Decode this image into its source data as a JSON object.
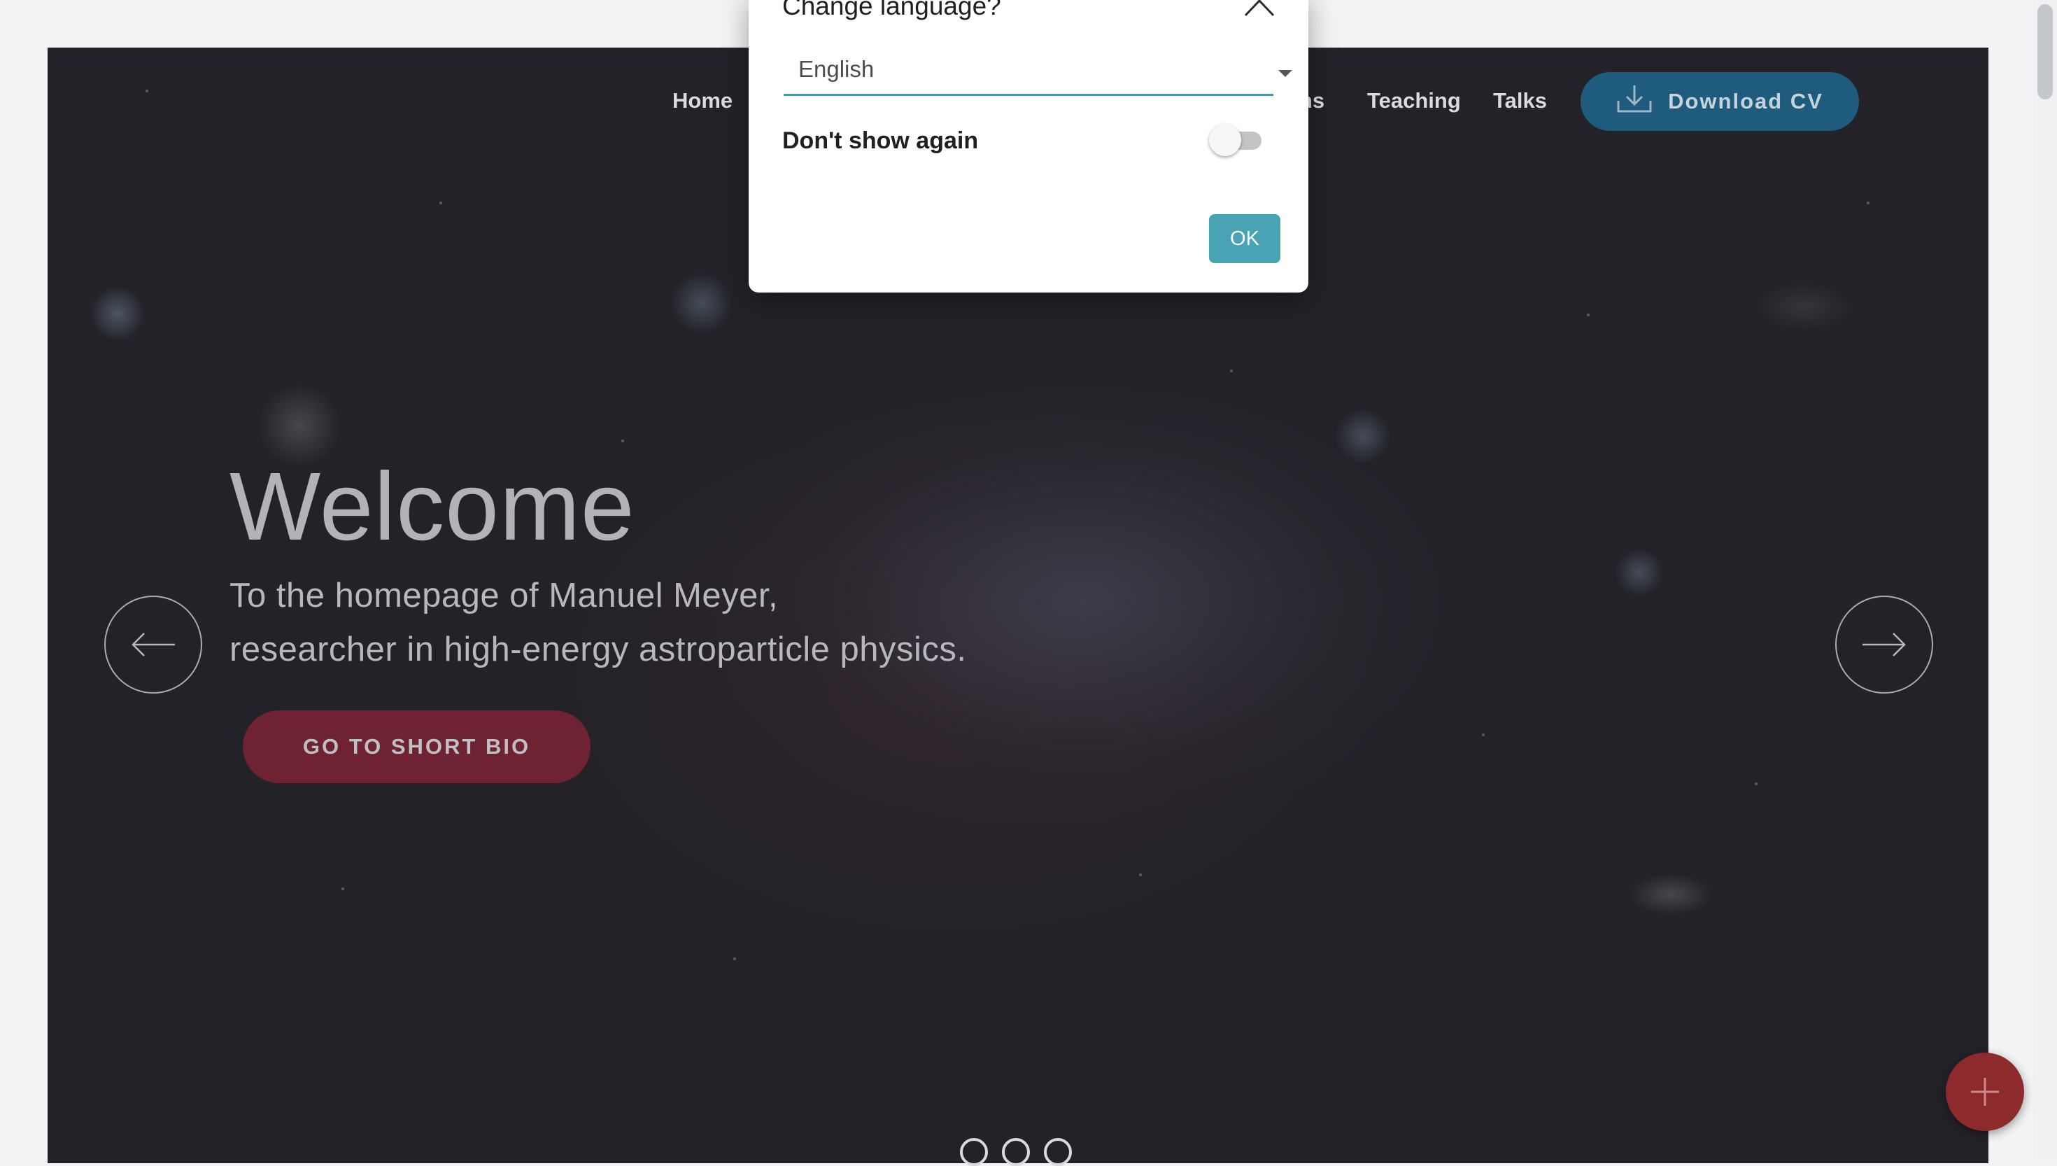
{
  "nav": {
    "home": "Home",
    "partial": "ons",
    "teaching": "Teaching",
    "talks": "Talks",
    "download_cv": "Download CV"
  },
  "hero": {
    "title": "Welcome",
    "line1": "To the homepage of Manuel Meyer,",
    "line2": "researcher in high-energy astroparticle physics.",
    "bio_button": "GO TO SHORT BIO"
  },
  "carousel": {
    "slide_count": 3
  },
  "modal": {
    "title": "Change language?",
    "selected_language": "English",
    "dont_show_label": "Don't show again",
    "dont_show_enabled": false,
    "ok_label": "OK"
  },
  "colors": {
    "cv_button": "#1e5b7c",
    "bio_button": "#6e2232",
    "ok_button": "#48a3b5",
    "fab": "#8d2a2c"
  },
  "icons": [
    "download-icon",
    "arrow-left-icon",
    "arrow-right-icon",
    "chevron-up-icon",
    "caret-down-icon",
    "plus-icon"
  ]
}
